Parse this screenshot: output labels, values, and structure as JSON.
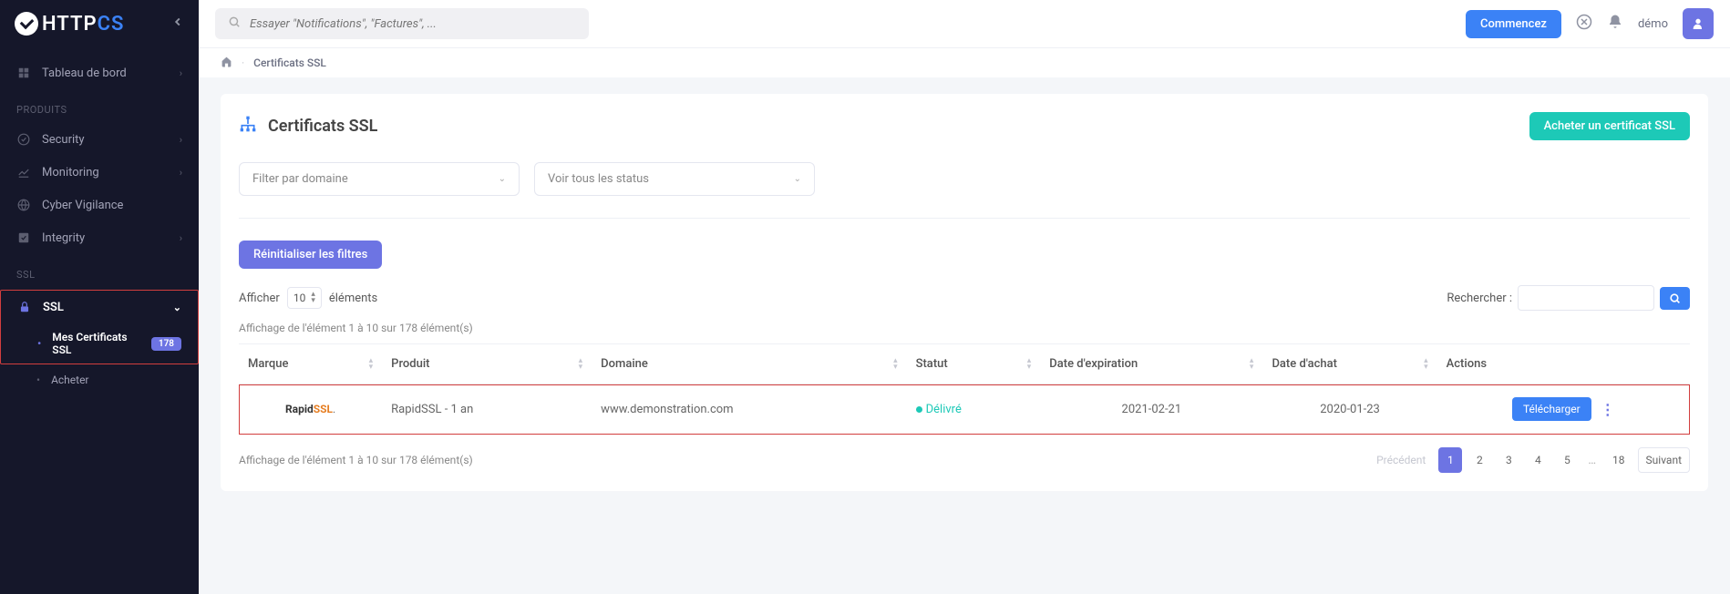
{
  "logo": {
    "part1": "HTTP",
    "part2": "CS"
  },
  "sidebar": {
    "dashboard": "Tableau de bord",
    "section_products": "PRODUITS",
    "security": "Security",
    "monitoring": "Monitoring",
    "cyber": "Cyber Vigilance",
    "integrity": "Integrity",
    "section_ssl": "SSL",
    "ssl": "SSL",
    "my_certs": "Mes Certificats SSL",
    "my_certs_count": "178",
    "buy": "Acheter"
  },
  "topbar": {
    "search_placeholder": "Essayer \"Notifications\", \"Factures\", ...",
    "start_button": "Commencez",
    "user": "démo"
  },
  "breadcrumb": {
    "current": "Certificats SSL"
  },
  "panel": {
    "title": "Certificats SSL",
    "buy_button": "Acheter un certificat SSL",
    "filter_domain": "Filter par domaine",
    "filter_status": "Voir tous les status",
    "reset_filters": "Réinitialiser les filtres"
  },
  "table": {
    "show_prefix": "Afficher",
    "show_count": "10",
    "show_suffix": "éléments",
    "search_label": "Rechercher :",
    "info": "Affichage de l'élément 1 à 10 sur 178 élément(s)",
    "columns": {
      "brand": "Marque",
      "product": "Produit",
      "domain": "Domaine",
      "status": "Statut",
      "expiration": "Date d'expiration",
      "purchase": "Date d'achat",
      "actions": "Actions"
    },
    "row": {
      "product": "RapidSSL - 1 an",
      "domain": "www.demonstration.com",
      "status": "Délivré",
      "expiration": "2021-02-21",
      "purchase": "2020-01-23",
      "download": "Télécharger"
    }
  },
  "brand": {
    "rapid": "Rapid",
    "ssl": "SSL",
    "dot": "."
  },
  "pagination": {
    "prev": "Précédent",
    "p1": "1",
    "p2": "2",
    "p3": "3",
    "p4": "4",
    "p5": "5",
    "ellipsis": "…",
    "last": "18",
    "next": "Suivant"
  }
}
